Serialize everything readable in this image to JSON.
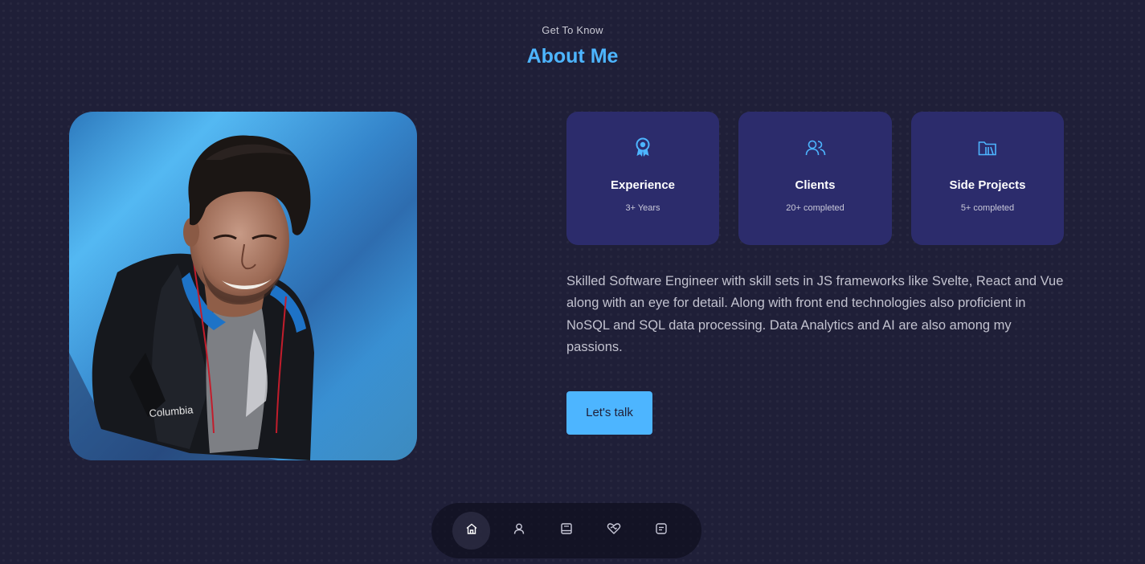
{
  "header": {
    "subtitle": "Get To Know",
    "title": "About Me"
  },
  "portrait": {
    "alt": "Portrait photo",
    "logo_text": "Columbia"
  },
  "cards": [
    {
      "icon": "award-icon",
      "title": "Experience",
      "subtitle": "3+ Years"
    },
    {
      "icon": "users-icon",
      "title": "Clients",
      "subtitle": "20+ completed"
    },
    {
      "icon": "folder-library-icon",
      "title": "Side Projects",
      "subtitle": "5+ completed"
    }
  ],
  "description": "Skilled Software Engineer with skill sets in JS frameworks like Svelte, React and Vue along with an eye for detail. Along with front end technologies also proficient in NoSQL and SQL data processing. Data Analytics and AI are also among my passions.",
  "cta": {
    "label": "Let's talk"
  },
  "nav": {
    "items": [
      {
        "icon": "home-icon",
        "active": true
      },
      {
        "icon": "user-icon",
        "active": false
      },
      {
        "icon": "book-icon",
        "active": false
      },
      {
        "icon": "heart-handshake-icon",
        "active": false
      },
      {
        "icon": "message-icon",
        "active": false
      }
    ]
  },
  "colors": {
    "background": "#1f1f38",
    "accent": "#4db5ff",
    "card": "#2c2c6c",
    "text_light": "#c2c2cf"
  }
}
